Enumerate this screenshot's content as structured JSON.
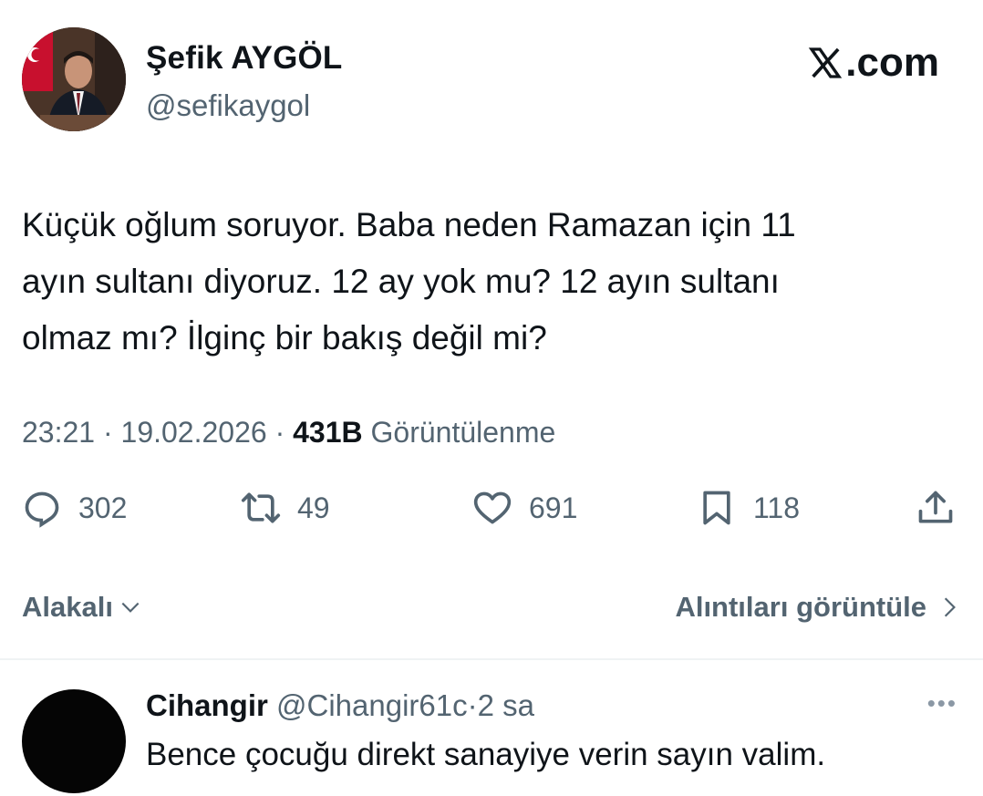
{
  "author": {
    "name": "Şefik AYGÖL",
    "handle": "@sefikaygol"
  },
  "brand": {
    "label": ".com"
  },
  "tweet": {
    "text_lines": [
      "Küçük oğlum soruyor. Baba neden Ramazan için 11",
      "ayın sultanı diyoruz. 12 ay yok mu? 12 ayın sultanı",
      "olmaz mı? İlginç bir bakış değil mi?"
    ],
    "time": "23:21",
    "date": "19.02.2026",
    "views_count": "431B",
    "views_label": "Görüntülenme"
  },
  "actions": {
    "replies": "302",
    "reposts": "49",
    "likes": "691",
    "bookmarks": "118"
  },
  "links": {
    "related": "Alakalı",
    "quotes": "Alıntıları görüntüle"
  },
  "reply": {
    "name": "Cihangir",
    "handle": "@Cihangir61c",
    "time": "2 sa",
    "text": "Bence çocuğu direkt sanayiye verin sayın valim."
  },
  "colors": {
    "text": "#0f1419",
    "secondary": "#536471",
    "divider": "#eff3f4"
  }
}
